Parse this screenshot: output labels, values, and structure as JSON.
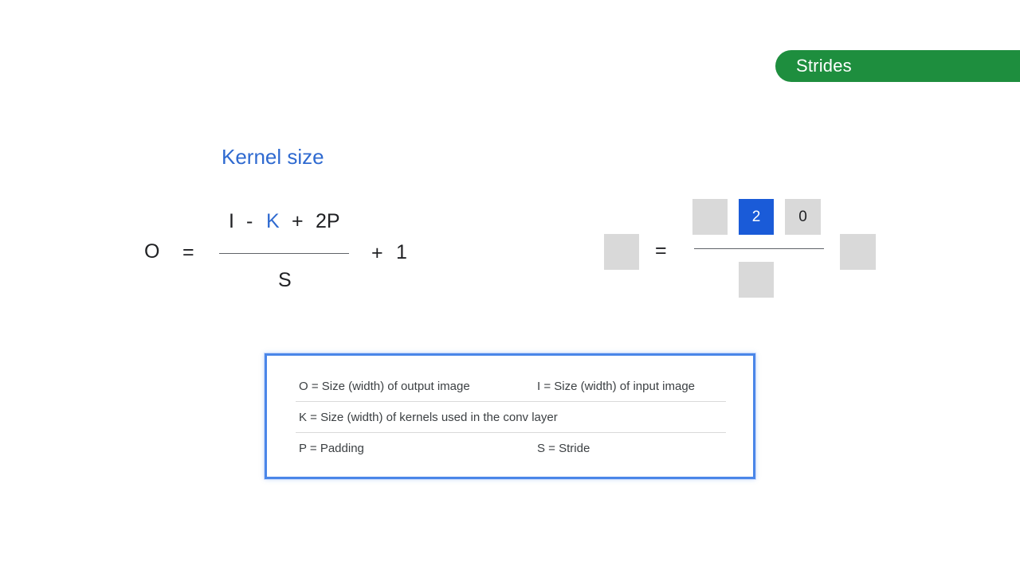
{
  "section": {
    "label": "Strides",
    "color": "#1e8e3e"
  },
  "heading": {
    "text": "Kernel size",
    "color": "#2f6ad0"
  },
  "formula": {
    "output": "O",
    "equals": "=",
    "numerator": {
      "input": "I",
      "minus": "-",
      "kernel": "K",
      "plus": "+",
      "padding": "2P"
    },
    "denominator": "S",
    "plus_one_sign": "+",
    "plus_one_value": "1"
  },
  "worked_example": {
    "equals": "=",
    "numerator_values": [
      "",
      "2",
      "0"
    ],
    "active_index": 1,
    "active_color": "#1a5bd8"
  },
  "legend": {
    "rows": [
      {
        "left": "O = Size (width) of output image",
        "right": "I = Size (width) of input image"
      },
      {
        "left": "K = Size (width) of kernels used in the conv layer",
        "right": ""
      },
      {
        "left": "P = Padding",
        "right": "S = Stride"
      }
    ]
  }
}
